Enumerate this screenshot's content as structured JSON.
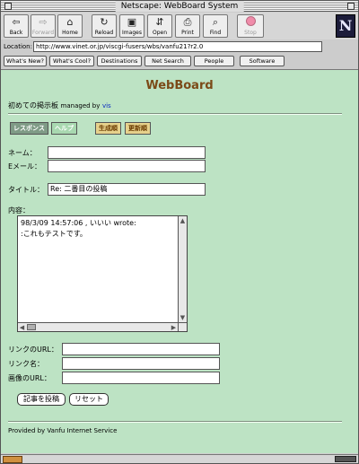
{
  "window": {
    "title": "Netscape: WebBoard System"
  },
  "toolbar": {
    "buttons": [
      {
        "label": "Back",
        "icon": "back-arrow-icon",
        "glyph": "⇦"
      },
      {
        "label": "Forward",
        "icon": "forward-arrow-icon",
        "glyph": "⇨"
      },
      {
        "label": "Home",
        "icon": "home-icon",
        "glyph": "⌂"
      },
      {
        "label": "Reload",
        "icon": "reload-icon",
        "glyph": "↻"
      },
      {
        "label": "Images",
        "icon": "images-icon",
        "glyph": "▣"
      },
      {
        "label": "Open",
        "icon": "open-icon",
        "glyph": "⇵"
      },
      {
        "label": "Print",
        "icon": "print-icon",
        "glyph": "⎙"
      },
      {
        "label": "Find",
        "icon": "find-icon",
        "glyph": "⌕"
      },
      {
        "label": "Stop",
        "icon": "stop-icon",
        "glyph": ""
      }
    ],
    "logo": "N"
  },
  "location": {
    "label": "Location:",
    "url": "http://www.vinet.or.jp/viscgi-fusers/wbs/vanfu21?r2.0"
  },
  "directory_buttons": [
    "What's New?",
    "What's Cool?",
    "Destinations",
    "Net Search",
    "People",
    "Software"
  ],
  "page": {
    "title": "WebBoard",
    "board_name": "初めての掲示板",
    "managed_by": "managed by",
    "owner": "vis",
    "nav": {
      "response": "レスポンス",
      "help": "ヘルプ",
      "created_order": "生成順",
      "updated_order": "更新順"
    },
    "form": {
      "name_label": "ネーム：",
      "name_value": "",
      "email_label": "Eメール：",
      "email_value": "",
      "title_label": "タイトル：",
      "title_value": "Re: 二番目の投稿",
      "body_label": "内容：",
      "body_value": "98/3/09 14:57:06 , いいい wrote:\n:これもテストです。",
      "link_url_label": "リンクのURL：",
      "link_url_value": "",
      "link_name_label": "リンク名：",
      "link_name_value": "",
      "image_url_label": "画像のURL：",
      "image_url_value": "",
      "submit_label": "記事を投稿",
      "reset_label": "リセット"
    },
    "footer": "Provided by Vanfu Internet Service"
  },
  "status": {
    "text": ""
  },
  "colors": {
    "content_bg": "#bde3c4",
    "title_brown": "#7b4a17",
    "owner_link": "#0a2bbf"
  }
}
